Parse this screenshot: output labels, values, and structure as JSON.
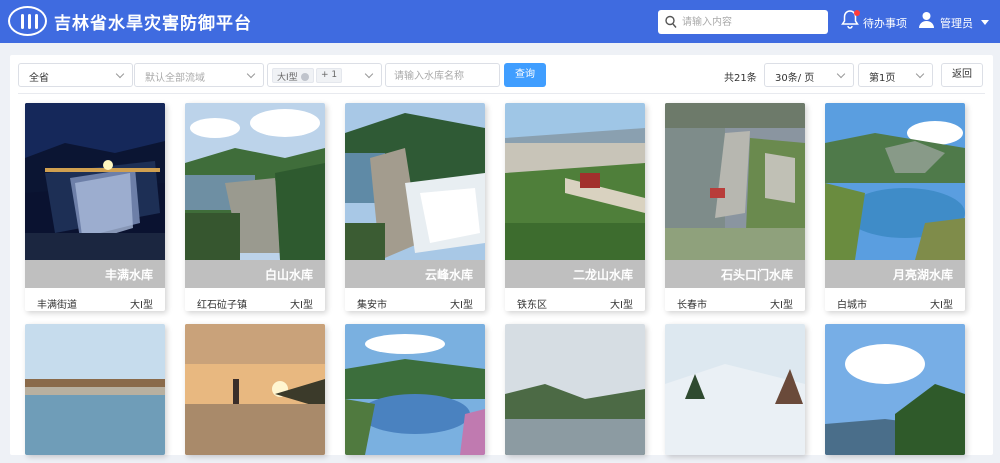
{
  "header": {
    "title": "吉林省水旱灾害防御平台",
    "search_placeholder": "请输入内容",
    "todo_label": "待办事项",
    "user_label": "管理员",
    "logo_icon": "water-conservancy-logo",
    "bg_color": "#3f6be0"
  },
  "filters": {
    "region": "全省",
    "basin_placeholder": "默认全部流域",
    "type_tag": "大I型",
    "type_more": "+ 1",
    "name_placeholder": "请输入水库名称",
    "query_label": "查询",
    "total": "共21条",
    "page_size": "30条/ 页",
    "page": "第1页",
    "back_label": "返回"
  },
  "reservoirs": [
    {
      "name": "丰满水库",
      "location": "丰满街道",
      "type": "大I型",
      "scene": "night-dam"
    },
    {
      "name": "白山水库",
      "location": "红石砬子镇",
      "type": "大I型",
      "scene": "arch-dam"
    },
    {
      "name": "云峰水库",
      "location": "集安市",
      "type": "大I型",
      "scene": "spillway"
    },
    {
      "name": "二龙山水库",
      "location": "铁东区",
      "type": "大I型",
      "scene": "park"
    },
    {
      "name": "石头口门水库",
      "location": "长春市",
      "type": "大I型",
      "scene": "aerial"
    },
    {
      "name": "月亮湖水库",
      "location": "白城市",
      "type": "大I型",
      "scene": "lake"
    },
    {
      "scene": "sluice"
    },
    {
      "scene": "sunset"
    },
    {
      "scene": "valley"
    },
    {
      "scene": "cloudy"
    },
    {
      "scene": "snow"
    },
    {
      "scene": "sky"
    }
  ]
}
